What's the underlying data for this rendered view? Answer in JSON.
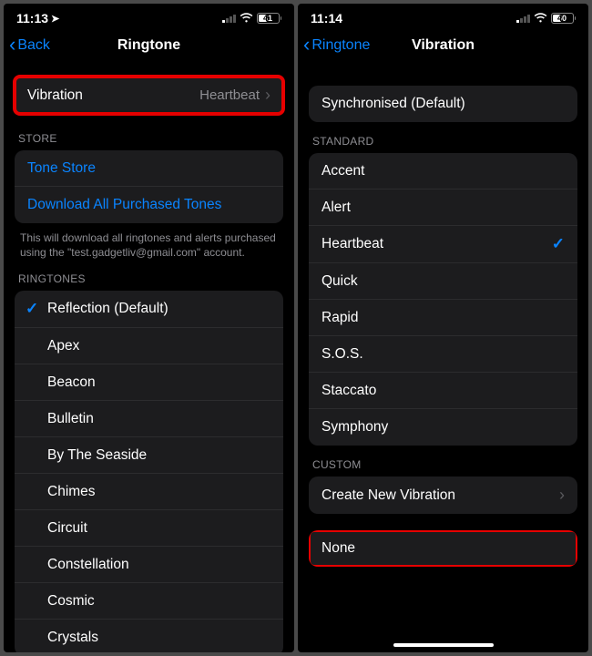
{
  "left": {
    "status": {
      "time": "11:13",
      "battery": "41",
      "battery_fill_pct": 41
    },
    "nav": {
      "back": "Back",
      "title": "Ringtone"
    },
    "vibration_row": {
      "label": "Vibration",
      "value": "Heartbeat"
    },
    "store": {
      "header": "STORE",
      "tone_store": "Tone Store",
      "download": "Download All Purchased Tones",
      "footer": "This will download all ringtones and alerts purchased using the \"test.gadgetliv@gmail.com\" account."
    },
    "ringtones": {
      "header": "RINGTONES",
      "items": [
        {
          "label": "Reflection (Default)",
          "checked": true
        },
        {
          "label": "Apex",
          "checked": false
        },
        {
          "label": "Beacon",
          "checked": false
        },
        {
          "label": "Bulletin",
          "checked": false
        },
        {
          "label": "By The Seaside",
          "checked": false
        },
        {
          "label": "Chimes",
          "checked": false
        },
        {
          "label": "Circuit",
          "checked": false
        },
        {
          "label": "Constellation",
          "checked": false
        },
        {
          "label": "Cosmic",
          "checked": false
        },
        {
          "label": "Crystals",
          "checked": false
        }
      ]
    }
  },
  "right": {
    "status": {
      "time": "11:14",
      "battery": "40",
      "battery_fill_pct": 40
    },
    "nav": {
      "back": "Ringtone",
      "title": "Vibration"
    },
    "synchronised": "Synchronised (Default)",
    "standard": {
      "header": "STANDARD",
      "items": [
        {
          "label": "Accent",
          "checked": false
        },
        {
          "label": "Alert",
          "checked": false
        },
        {
          "label": "Heartbeat",
          "checked": true
        },
        {
          "label": "Quick",
          "checked": false
        },
        {
          "label": "Rapid",
          "checked": false
        },
        {
          "label": "S.O.S.",
          "checked": false
        },
        {
          "label": "Staccato",
          "checked": false
        },
        {
          "label": "Symphony",
          "checked": false
        }
      ]
    },
    "custom": {
      "header": "CUSTOM",
      "create": "Create New Vibration"
    },
    "none": "None"
  }
}
